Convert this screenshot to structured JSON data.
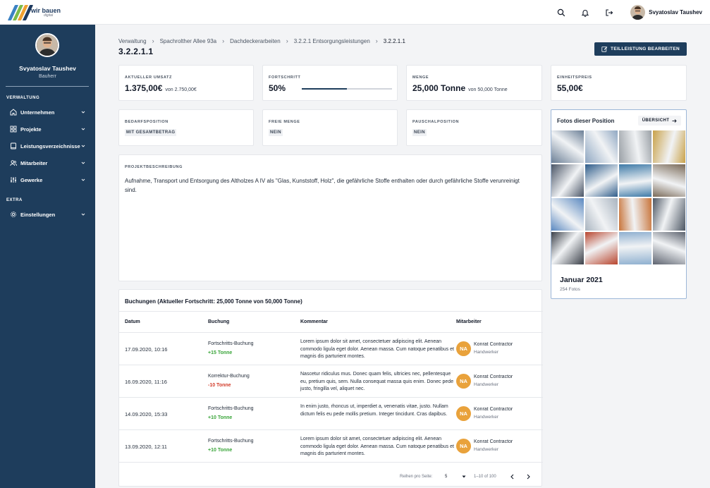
{
  "app": {
    "logo_text": "wir bauen",
    "logo_sub": "digital",
    "brand_colors": [
      "#3b82c4",
      "#7dbb4a",
      "#f0a030",
      "#1e3a5f"
    ],
    "user_name": "Svyatoslav Taushev"
  },
  "topbar": {
    "icons": [
      "search-icon",
      "bell-icon",
      "logout-icon"
    ]
  },
  "sidebar": {
    "user_name": "Svyatoslav Taushev",
    "user_role": "Bauherr",
    "section_verwaltung": "VERWALTUNG",
    "section_extra": "EXTRA",
    "items": [
      {
        "label": "Unternehmen",
        "icon": "home-icon"
      },
      {
        "label": "Projekte",
        "icon": "grid-icon"
      },
      {
        "label": "Leistungsverzeichnisse",
        "icon": "book-icon"
      },
      {
        "label": "Mitarbeiter",
        "icon": "users-icon"
      },
      {
        "label": "Gewerke",
        "icon": "sliders-icon"
      },
      {
        "label": "Einstellungen",
        "icon": "gear-icon"
      }
    ]
  },
  "breadcrumb": [
    "Verwaltung",
    "Spachrolther Allee 93a",
    "Dachdeckerarbeiten",
    "3.2.2.1 Entsorgungsleistungen",
    "3.2.2.1.1"
  ],
  "page": {
    "title": "3.2.2.1.1",
    "edit_button": "TEILLEISTUNG BEARBEITEN"
  },
  "stats": {
    "umsatz": {
      "label": "AKTUELLER UMSATZ",
      "value": "1.375,00€",
      "sub": "von 2.750,00€"
    },
    "fortschritt": {
      "label": "FORTSCHRITT",
      "value": "50%",
      "fraction": 0.5
    },
    "menge": {
      "label": "MENGE",
      "value": "25,000 Tonne",
      "sub": "von 50,000 Tonne"
    },
    "einheitspreis": {
      "label": "EINHEITSPREIS",
      "value": "55,00€"
    }
  },
  "flags": {
    "bedarf": {
      "label": "BEDARFSPOSITION",
      "value": "MIT GESAMTBETRAG"
    },
    "freie": {
      "label": "FREIE MENGE",
      "value": "NEIN"
    },
    "pauschal": {
      "label": "PAUSCHALPOSITION",
      "value": "NEIN"
    }
  },
  "description": {
    "label": "PROJEKTBESCHREIBUNG",
    "text": "Aufnahme, Transport und Entsorgung des Altholzes A IV als \"Glas, Kunststoff, Holz\", die gefährliche Stoffe enthalten oder durch gefährliche Stoffe verunreinigt sind."
  },
  "photos": {
    "title": "Fotos dieser Position",
    "overview_button": "ÜBERSICHT",
    "month": "Januar 2021",
    "count": "254 Fotos",
    "tile_colors": [
      "#6b7f96",
      "#8fa7c2",
      "#9aa0a6",
      "#c9a24a",
      "#4a5566",
      "#2e5c8a",
      "#3e7aa8",
      "#7a6a58",
      "#5a88c0",
      "#a9b4c0",
      "#c8743a",
      "#4c5663",
      "#3a3f48",
      "#b8452e",
      "#8fb0d0",
      "#5e6470"
    ]
  },
  "bookings": {
    "title": "Buchungen (Aktueller Fortschritt: 25,000 Tonne von 50,000 Tonne)",
    "headers": {
      "datum": "Datum",
      "buchung": "Buchung",
      "kommentar": "Kommentar",
      "mitarbeiter": "Mitarbeiter"
    },
    "rows": [
      {
        "date": "17.09.2020, 10:16",
        "type": "Fortschritts-Buchung",
        "amount": "+15 Tonne",
        "amount_color": "#3aa53a",
        "comment": "Lorem ipsum dolor sit amet, consectetuer adipiscing elit. Aenean commodo ligula eget dolor. Aenean massa. Cum natoque penatibus et magnis dis parturient montes.",
        "initials": "NA",
        "employee": "Konrat Contractor",
        "role": "Handwerker"
      },
      {
        "date": "16.09.2020, 11:16",
        "type": "Korrektur-Buchung",
        "amount": "-10 Tonne",
        "amount_color": "#d23c2a",
        "comment": "Nascetur ridiculus mus. Donec quam felis, ultricies nec, pellentesque eu, pretium quis, sem. Nulla consequat massa quis enim. Donec pede justo, fringilla vel, aliquet nec.",
        "initials": "NA",
        "employee": "Konrat Contractor",
        "role": "Handwerker"
      },
      {
        "date": "14.09.2020, 15:33",
        "type": "Fortschritts-Buchung",
        "amount": "+10 Tonne",
        "amount_color": "#3aa53a",
        "comment": "In enim justo, rhoncus ut, imperdiet a, venenatis vitae, justo. Nullam dictum felis eu pede mollis pretium. Integer tincidunt. Cras dapibus.",
        "initials": "NA",
        "employee": "Konrat Contractor",
        "role": "Handwerker"
      },
      {
        "date": "13.09.2020, 12:11",
        "type": "Fortschritts-Buchung",
        "amount": "+10 Tonne",
        "amount_color": "#3aa53a",
        "comment": "Lorem ipsum dolor sit amet, consectetuer adipiscing elit. Aenean commodo ligula eget dolor. Aenean massa. Cum natoque penatibus et magnis dis parturient montes.",
        "initials": "NA",
        "employee": "Konrat Contractor",
        "role": "Handwerker"
      }
    ],
    "pagination": {
      "rows_label": "Reihen pro Seite:",
      "rows_value": "5",
      "range": "1–10 of 100"
    }
  }
}
